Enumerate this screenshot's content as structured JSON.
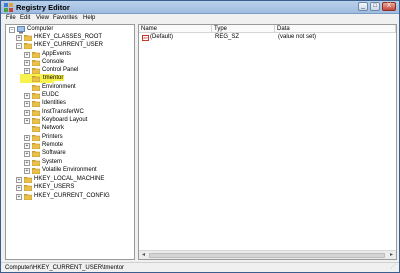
{
  "window": {
    "title": "Registry Editor"
  },
  "window_buttons": {
    "minimize": "_",
    "maximize": "□",
    "close": "X"
  },
  "menu": [
    "File",
    "Edit",
    "View",
    "Favorites",
    "Help"
  ],
  "tree": {
    "root": "Computer",
    "items": [
      {
        "label": "HKEY_CLASSES_ROOT",
        "expander": "+"
      },
      {
        "label": "HKEY_CURRENT_USER",
        "expander": "−"
      },
      {
        "label": "AppEvents",
        "expander": "+"
      },
      {
        "label": "Console",
        "expander": "+"
      },
      {
        "label": "Control Panel",
        "expander": "+"
      },
      {
        "label": "tmentor",
        "expander": ""
      },
      {
        "label": "Environment",
        "expander": ""
      },
      {
        "label": "EUDC",
        "expander": "+"
      },
      {
        "label": "Identities",
        "expander": "+"
      },
      {
        "label": "InstTransferWC",
        "expander": "+"
      },
      {
        "label": "Keyboard Layout",
        "expander": "+"
      },
      {
        "label": "Network",
        "expander": ""
      },
      {
        "label": "Printers",
        "expander": "+"
      },
      {
        "label": "Remote",
        "expander": "+"
      },
      {
        "label": "Software",
        "expander": "+"
      },
      {
        "label": "System",
        "expander": "+"
      },
      {
        "label": "Volatile Environment",
        "expander": "+"
      },
      {
        "label": "HKEY_LOCAL_MACHINE",
        "expander": "+"
      },
      {
        "label": "HKEY_USERS",
        "expander": "+"
      },
      {
        "label": "HKEY_CURRENT_CONFIG",
        "expander": "+"
      }
    ]
  },
  "list": {
    "headers": {
      "name": "Name",
      "type": "Type",
      "data": "Data"
    },
    "rows": [
      {
        "icon": "ab",
        "name": "(Default)",
        "type": "REG_SZ",
        "data": "(value not set)"
      }
    ]
  },
  "scrollbar": {
    "left": "◂",
    "right": "▸"
  },
  "status": {
    "path": "Computer\\HKEY_CURRENT_USER\\tmentor"
  },
  "colors": {
    "highlight": "#f8f24e",
    "folder": "#e8c04a",
    "title_bar": "#b9d1ea"
  },
  "icons": {
    "app": "registry-editor-icon",
    "computer": "computer-icon",
    "folder": "folder-icon",
    "value": "string-value-icon"
  }
}
